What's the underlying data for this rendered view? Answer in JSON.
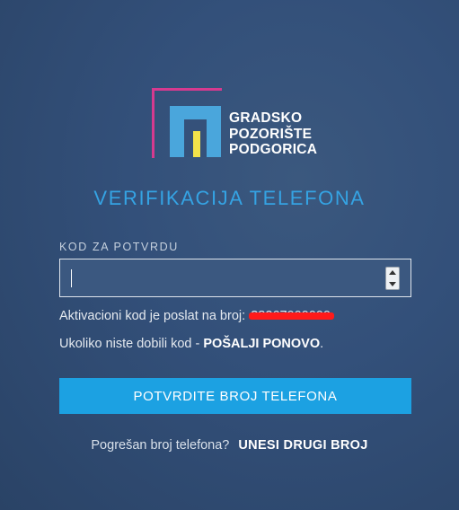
{
  "logo": {
    "lines": [
      "GRADSKO",
      "POZORIŠTE",
      "PODGORICA"
    ]
  },
  "title": "VERIFIKACIJA TELEFONA",
  "code_field": {
    "label": "KOD ZA POTVRDU",
    "value": "",
    "placeholder": ""
  },
  "info": {
    "sent_text": "Aktivacioni kod je poslat na broj:",
    "phone_number": "38267000000",
    "not_received_text": "Ukoliko niste dobili kod -",
    "resend_link": "POŠALJI PONOVO",
    "resend_suffix": "."
  },
  "confirm_button": "POTVRDITE BROJ TELEFONA",
  "wrong_number": {
    "text": "Pogrešan broj telefona?",
    "link": "UNESI DRUGI BROJ"
  },
  "colors": {
    "accent": "#1ca1e2",
    "title": "#35a3e3",
    "logo_frame": "#d63a8f",
    "logo_mark": "#4aa6dc",
    "logo_bar": "#f3e24a",
    "redaction": "#ff1a1a"
  }
}
